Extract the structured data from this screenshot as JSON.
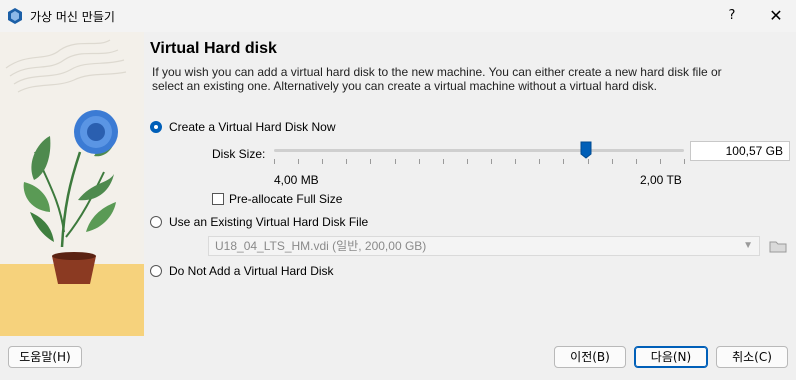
{
  "window": {
    "title": "가상 머신 만들기",
    "help_label": "?",
    "close_label": "✕",
    "app_icon": "virtualbox-icon"
  },
  "page": {
    "heading": "Virtual Hard disk",
    "description": "If you wish you can add a virtual hard disk to the new machine. You can either create a new hard disk file or select an existing one. Alternatively you can create a virtual machine without a virtual hard disk."
  },
  "options": {
    "create_new": {
      "label": "Create a Virtual Hard Disk Now",
      "selected": true
    },
    "use_existing": {
      "label": "Use an Existing Virtual Hard Disk File",
      "selected": false
    },
    "do_not_add": {
      "label": "Do Not Add a Virtual Hard Disk",
      "selected": false
    }
  },
  "disk_size": {
    "label": "Disk Size:",
    "value": "100,57 GB",
    "min_label": "4,00 MB",
    "max_label": "2,00 TB",
    "slider_fraction": 0.76,
    "tick_count": 18
  },
  "preallocate": {
    "label": "Pre-allocate Full Size",
    "checked": false
  },
  "existing_file": {
    "selected": "U18_04_LTS_HM.vdi (일반, 200,00 GB)",
    "chevron_icon": "chevron-down-icon",
    "browse_icon": "folder-icon"
  },
  "footer": {
    "help": "도움말(H)",
    "back": "이전(B)",
    "next": "다음(N)",
    "cancel": "취소(C)"
  },
  "colors": {
    "accent": "#005fb8",
    "sidebar_bg": "#f3f0ea",
    "flower": "#3b7bd4",
    "pot": "#8b3a22",
    "table": "#f6d27c"
  }
}
